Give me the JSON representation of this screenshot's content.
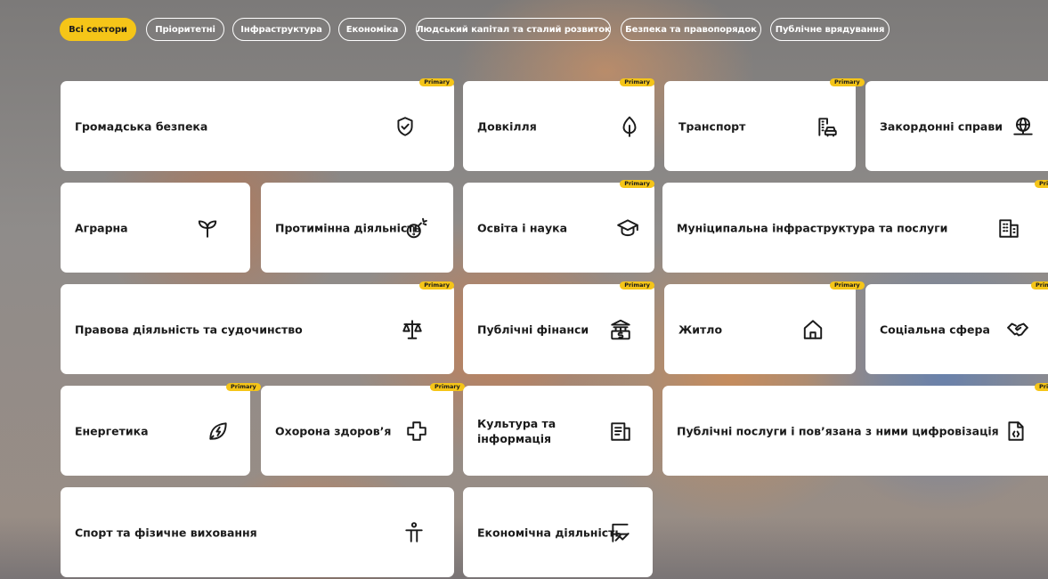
{
  "filters": [
    {
      "label": "Всі сектори",
      "active": true
    },
    {
      "label": "Пріоритетні",
      "active": false
    },
    {
      "label": "Інфраструктура",
      "active": false
    },
    {
      "label": "Економіка",
      "active": false
    },
    {
      "label": "Людський капітал та сталий розвиток",
      "active": false
    },
    {
      "label": "Безпека та правопорядок",
      "active": false
    },
    {
      "label": "Публічне врядування",
      "active": false
    }
  ],
  "colors": {
    "accent": "#f5c518",
    "card": "#ffffff",
    "text": "#1b1b1b"
  },
  "badge_text": "Primary",
  "sectors": [
    {
      "label": "Громадська безпека",
      "icon": "shield-check-icon",
      "primary": true
    },
    {
      "label": "Довкілля",
      "icon": "leaf-icon",
      "primary": true
    },
    {
      "label": "Транспорт",
      "icon": "city-car-icon",
      "primary": true
    },
    {
      "label": "Закордонні справи",
      "icon": "globe-stand-icon",
      "primary": false
    },
    {
      "label": "Аграрна",
      "icon": "sprout-icon",
      "primary": false
    },
    {
      "label": "Протимінна діяльність",
      "icon": "mine-icon",
      "primary": false
    },
    {
      "label": "Освіта і наука",
      "icon": "graduation-cap-icon",
      "primary": true
    },
    {
      "label": "Муніципальна інфраструктура та послуги",
      "icon": "building-icon",
      "primary": true
    },
    {
      "label": "Правова діяльність та судочинство",
      "icon": "scales-icon",
      "primary": true
    },
    {
      "label": "Публічні фінанси",
      "icon": "bank-money-icon",
      "primary": true
    },
    {
      "label": "Житло",
      "icon": "house-icon",
      "primary": true
    },
    {
      "label": "Соціальна сфера",
      "icon": "handshake-icon",
      "primary": true
    },
    {
      "label": "Енергетика",
      "icon": "energy-leaf-icon",
      "primary": true
    },
    {
      "label": "Охорона здоров’я",
      "icon": "medical-cross-icon",
      "primary": true
    },
    {
      "label": "Культура та інформація",
      "icon": "newspaper-icon",
      "primary": false
    },
    {
      "label": "Публічні послуги і пов’язана з ними цифровізація",
      "icon": "digital-document-icon",
      "primary": true
    },
    {
      "label": "Спорт та фізичне виховання",
      "icon": "athlete-icon",
      "primary": false
    },
    {
      "label": "Економічна діяльність",
      "icon": "chart-icon",
      "primary": false
    }
  ]
}
